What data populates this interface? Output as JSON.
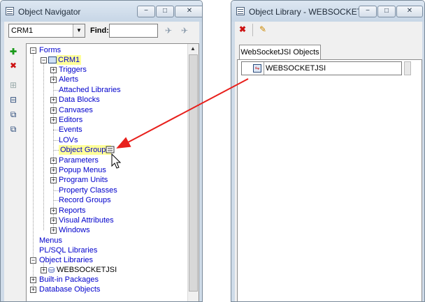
{
  "navigator": {
    "title": "Object Navigator",
    "minimize": "−",
    "maximize": "□",
    "close": "✕",
    "module_select": "CRM1",
    "find_label": "Find:",
    "find_value": "",
    "tools": [
      {
        "name": "create-icon",
        "glyph": "✚"
      },
      {
        "name": "delete-icon",
        "glyph": "✖"
      },
      {
        "name": "expand-icon",
        "glyph": "⊞"
      },
      {
        "name": "collapse-icon",
        "glyph": "⊟"
      },
      {
        "name": "expand-all-icon",
        "glyph": "⧉"
      },
      {
        "name": "collapse-all-icon",
        "glyph": "⧉"
      }
    ],
    "tree": {
      "forms": "Forms",
      "module": "CRM1",
      "children": [
        "Triggers",
        "Alerts",
        "Attached Libraries",
        "Data Blocks",
        "Canvases",
        "Editors",
        "Events",
        "LOVs",
        "Object Groups",
        "Parameters",
        "Popup Menus",
        "Program Units",
        "Property Classes",
        "Record Groups",
        "Reports",
        "Visual Attributes",
        "Windows"
      ],
      "expandable": [
        true,
        true,
        false,
        true,
        true,
        true,
        false,
        false,
        false,
        true,
        true,
        true,
        false,
        false,
        true,
        true,
        true
      ],
      "top_level": [
        "Menus",
        "PL/SQL Libraries",
        "Object Libraries"
      ],
      "library": "WEBSOCKETJSI",
      "after": [
        "Built-in Packages",
        "Database Objects"
      ]
    }
  },
  "library": {
    "title": "Object Library - WEBSOCKETJSI",
    "minimize": "−",
    "maximize": "□",
    "close": "✕",
    "tab": "WebSocketJSI Objects",
    "item": "WEBSOCKETJSI"
  },
  "colors": {
    "link": "#0000cc",
    "highlight": "#ffff99",
    "arrow": "#e8201c"
  }
}
